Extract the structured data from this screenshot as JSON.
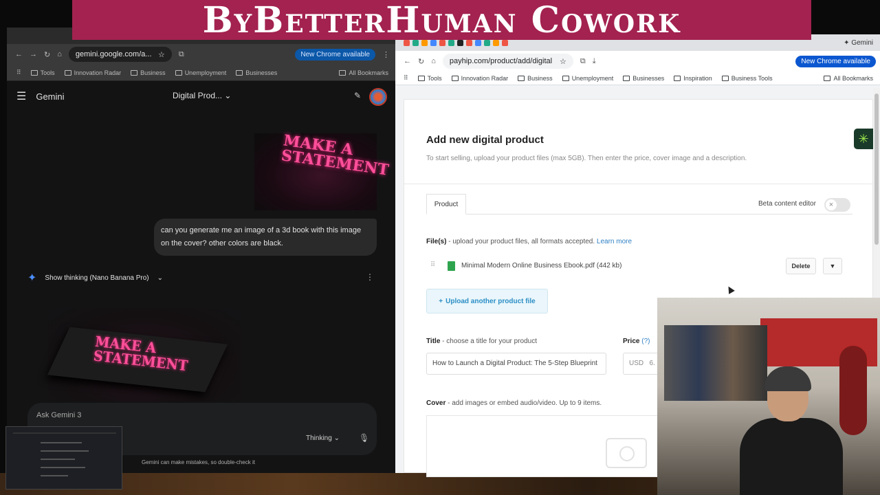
{
  "banner": {
    "text": "ByBetterHuman Cowork"
  },
  "left_browser": {
    "url": "gemini.google.com/a...",
    "new_chrome": "New Chrome available",
    "bookmarks": [
      "Tools",
      "Innovation Radar",
      "Business",
      "Unemployment",
      "Businesses"
    ],
    "all_bookmarks": "All Bookmarks"
  },
  "gemini": {
    "app_name": "Gemini",
    "conversation_title": "Digital Prod...",
    "image1_text": "MAKE A STATEMENT",
    "prompt": "can you generate me an image of a 3d book with this image on the cover? other colors are black.",
    "thinking_label": "Show thinking (Nano Banana Pro)",
    "image2_text": "MAKE A STATEMENT",
    "input_placeholder": "Ask Gemini 3",
    "mode": "Thinking",
    "disclaimer": "Gemini can make mistakes, so double-check it"
  },
  "right_browser": {
    "url": "payhip.com/product/add/digital",
    "new_chrome": "New Chrome available",
    "bookmarks": [
      "Tools",
      "Innovation Radar",
      "Business",
      "Unemployment",
      "Businesses",
      "Inspiration",
      "Business Tools"
    ],
    "all_bookmarks": "All Bookmarks"
  },
  "payhip": {
    "title": "Add new digital product",
    "subtitle": "To start selling, upload your product files (max 5GB). Then enter the price, cover image and a description.",
    "tab_product": "Product",
    "beta_label": "Beta content editor",
    "files_label_bold": "File(s)",
    "files_label_rest": " - upload your product files, all formats accepted. ",
    "learn_more": "Learn more",
    "file_name": "Minimal Modern Online Business Ebook.pdf (442 kb)",
    "delete": "Delete",
    "upload_another": "Upload another product file",
    "title_label_bold": "Title",
    "title_label_rest": " - choose a title for your product",
    "title_value": "How to Launch a Digital Product: The 5-Step Blueprint",
    "price_label_bold": "Price",
    "price_q": "(?)",
    "price_currency": "USD",
    "price_value": "6.",
    "cover_label_bold": "Cover",
    "cover_label_rest": " - add images or embed audio/video. Up to 9 items."
  }
}
